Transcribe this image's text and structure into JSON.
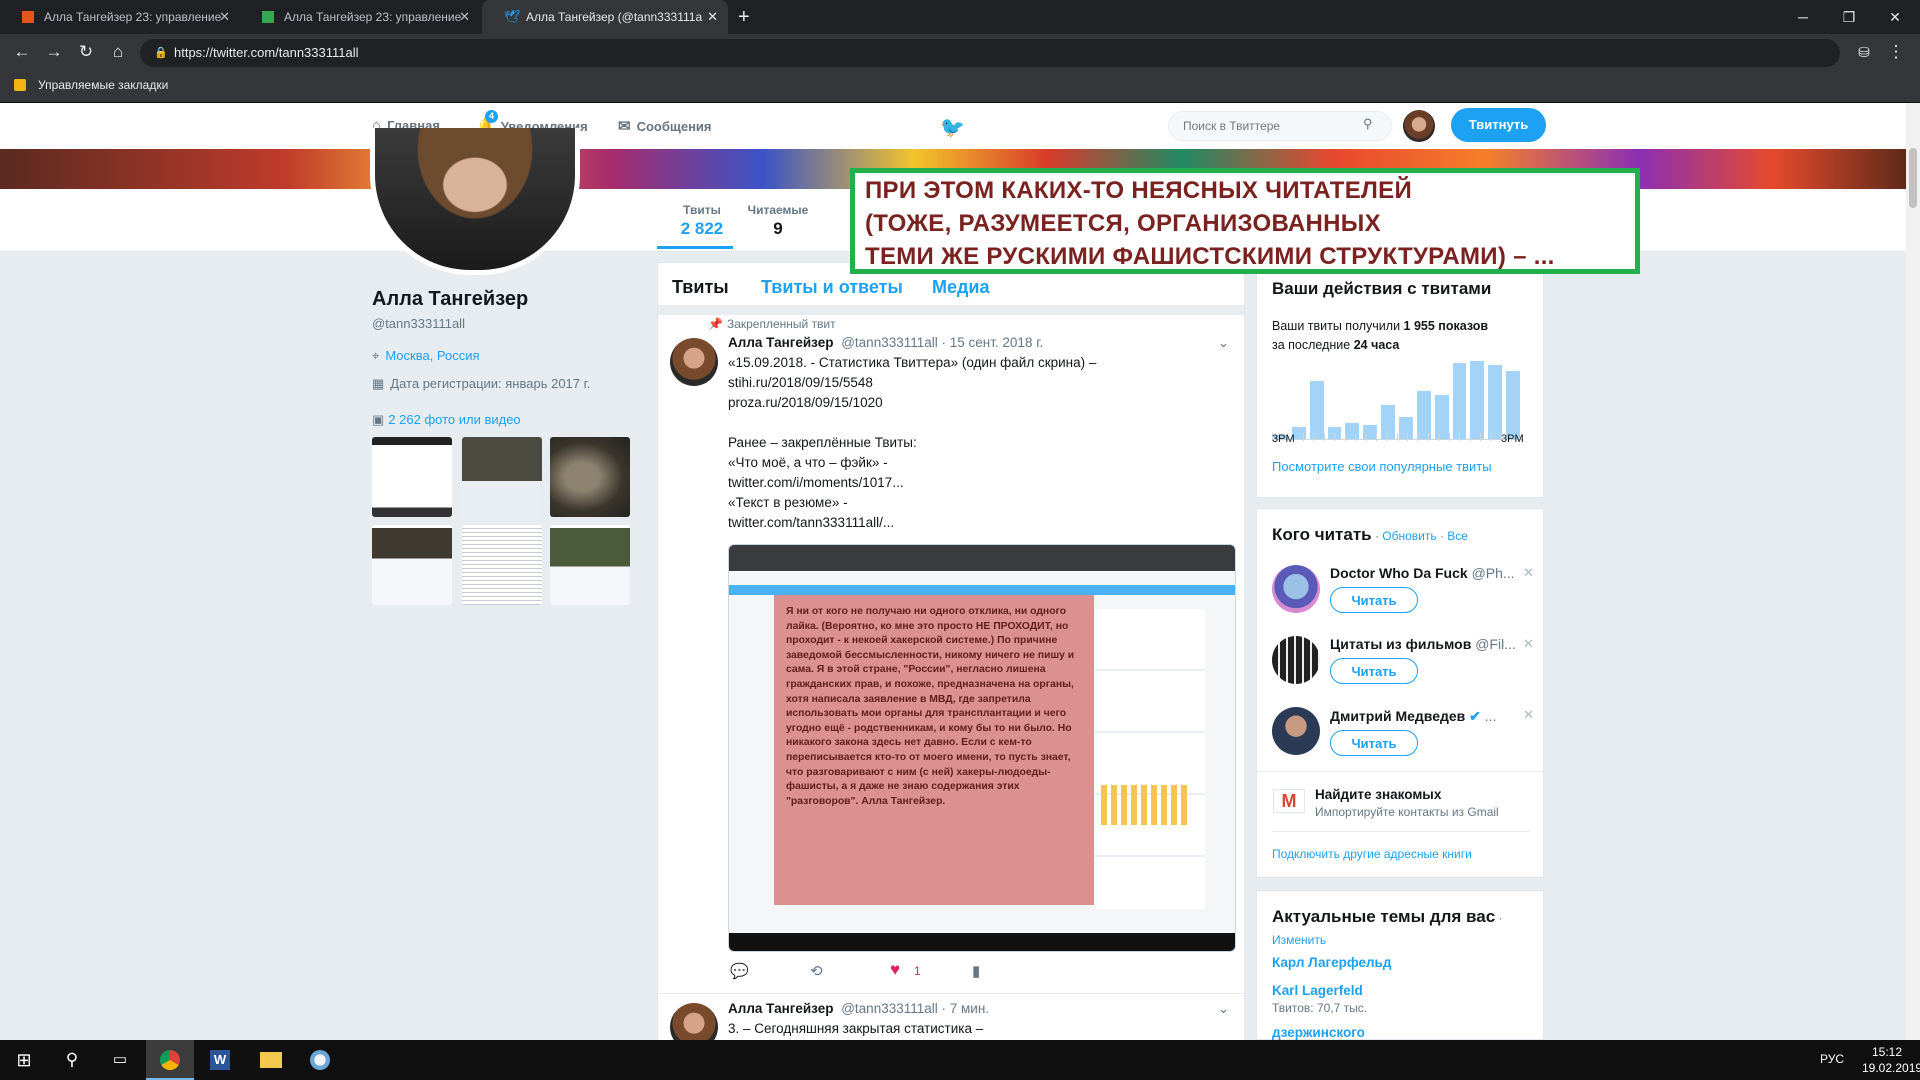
{
  "browser": {
    "tabs": [
      {
        "title": "Алла Тангейзер 23: управление",
        "favicon_color": "#e5541b"
      },
      {
        "title": "Алла Тангейзер 23: управление",
        "favicon_color": "#34a853"
      },
      {
        "title": "Алла Тангейзер (@tann333111a",
        "favicon_color": "#1da1f2"
      }
    ],
    "new_tab": "+",
    "url": "https://twitter.com/tann333111all",
    "bookmarks_label": "Управляемые закладки"
  },
  "twitter_nav": {
    "home": "Главная",
    "notifications": "Уведомления",
    "notifications_count": "4",
    "messages": "Сообщения",
    "search_placeholder": "Поиск в Твиттере",
    "tweet_button": "Твитнуть"
  },
  "overlay_text": {
    "line1": "ПРИ ЭТОМ КАКИХ-ТО НЕЯСНЫХ ЧИТАТЕЛЕЙ",
    "line2": "(ТОЖЕ, РАЗУМЕЕТСЯ, ОРГАНИЗОВАННЫХ",
    "line3": "ТЕМИ ЖЕ РУСКИМИ ФАШИСТСКИМИ СТРУКТУРАМИ) – ..."
  },
  "profile": {
    "name": "Алла Тангейзер",
    "handle": "@tann333111all",
    "location": "Москва, Россия",
    "joined": "Дата регистрации: январь 2017 г.",
    "media_link": "2 262 фото или видео",
    "stats": [
      {
        "label": "Твиты",
        "value": "2 822"
      },
      {
        "label": "Читаемые",
        "value": "9"
      }
    ]
  },
  "timeline": {
    "tabs": [
      "Твиты",
      "Твиты и ответы",
      "Медиа"
    ],
    "pinned_label": "Закрепленный твит",
    "tweet1": {
      "name": "Алла Тангейзер",
      "meta": "@tann333111all · 15 сент. 2018 г.",
      "line1": "«15.09.2018. - Статистика Твиттера» (один файл скрина) –",
      "link1": "stihi.ru/2018/09/15/5548",
      "link2": "proza.ru/2018/09/15/1020",
      "line2": "Ранее – закреплённые Твиты:",
      "line3": "«Что моё, а что – фэйк» -",
      "link3": "twitter.com/i/moments/1017...",
      "line4": "«Текст в резюме» -",
      "link4": "twitter.com/tann333111all/...",
      "likes": "1"
    },
    "tweet2": {
      "name": "Алла Тангейзер",
      "meta": "@tann333111all · 7 мин.",
      "line1": "3. – Сегодняшняя закрытая статистика –"
    },
    "image_text": "Я ни от кого не получаю ни одного отклика, ни одного лайка. (Вероятно, ко мне это просто НЕ ПРОХОДИТ, но проходит - к некоей хакерской системе.) По причине заведомой бессмысленности, никому ничего не пишу и сама. Я в этой стране, \"России\", негласно лишена гражданских прав, и похоже, предназначена на органы, хотя написала заявление в МВД, где запретила использовать мои органы для трансплантации и чего угодно ещё - родственникам, и кому бы то ни было. Но никакого закона здесь нет давно. Если с кем-то переписывается кто-то от моего имени, то пусть знает, что разговаривают с ним (с ней) хакеры-людоеды-фашисты, а я даже не знаю содержания этих \"разговоров\". Алла Тангейзер."
  },
  "activity": {
    "title": "Ваши действия с твитами",
    "text_a": "Ваши твиты получили ",
    "impressions": "1 955 показов",
    "text_b": "за последние ",
    "period": "24 часа",
    "axis_left": "3PM",
    "axis_right": "3PM",
    "link": "Посмотрите свои популярные твиты",
    "bars": [
      0.05,
      0.15,
      0.72,
      0.15,
      0.2,
      0.18,
      0.42,
      0.28,
      0.6,
      0.55,
      0.95,
      0.97,
      0.92,
      0.85
    ]
  },
  "who_to_follow": {
    "title": "Кого читать",
    "refresh": "Обновить",
    "all": "Все",
    "follow_label": "Читать",
    "accounts": [
      {
        "name": "Doctor Who Da Fuck",
        "handle": "@Ph..."
      },
      {
        "name": "Цитаты из фильмов",
        "handle": "@Fil..."
      },
      {
        "name": "Дмитрий Медведев",
        "handle": "..."
      }
    ],
    "find_title": "Найдите знакомых",
    "find_sub": "Импортируйте контакты из Gmail",
    "other_books": "Подключить другие адресные книги"
  },
  "trends": {
    "title": "Актуальные темы для вас",
    "change": "Изменить",
    "items": [
      {
        "name": "Карл Лагерфельд",
        "sub": ""
      },
      {
        "name": "Karl Lagerfeld",
        "sub": "Твитов: 70,7 тыс."
      },
      {
        "name": "дзержинского",
        "sub": ""
      }
    ]
  },
  "taskbar": {
    "lang": "РУС",
    "time": "15:12",
    "date": "19.02.2019"
  }
}
